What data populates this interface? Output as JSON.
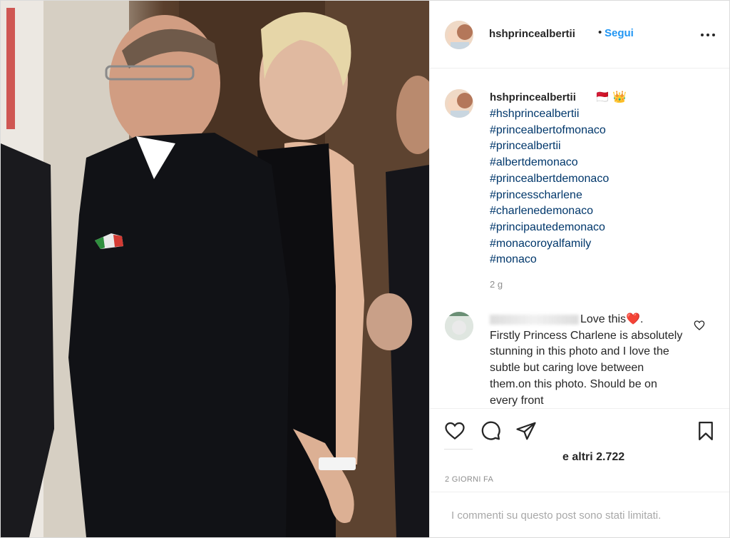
{
  "header": {
    "username": "hshprincealbertii",
    "separator": "•",
    "follow_label": "Segui"
  },
  "caption": {
    "username": "hshprincealbertii",
    "emoji": "🇲🇨 👑",
    "hashtags": [
      "#hshprincealbertii",
      "#princealbertofmonaco",
      "#princealbertii",
      "#albertdemonaco",
      "#princealbertdemonaco",
      "#princesscharlene",
      "#charlenedemonaco",
      "#principautedemonaco",
      "#monacoroyalfamily",
      "#monaco"
    ],
    "time": "2 g"
  },
  "comment": {
    "text_start": "Love this",
    "heart": "❤️",
    "text_end": ".",
    "body": "Firstly Princess Charlene is absolutely stunning in this photo and I love the subtle but caring love between them.on this photo. Should be on every front"
  },
  "likes": {
    "text": "e altri 2.722"
  },
  "date": "2 GIORNI FA",
  "footer": {
    "limited_text": "I commenti su questo post sono stati limitati."
  },
  "colors": {
    "follow_blue": "#2196f3",
    "hashtag_blue": "#00376b",
    "muted": "#8e8e8e",
    "heart_red": "#ed4956"
  },
  "icons": [
    "more-options-icon",
    "heart-icon",
    "comment-icon",
    "share-icon",
    "bookmark-icon",
    "like-comment-icon"
  ]
}
